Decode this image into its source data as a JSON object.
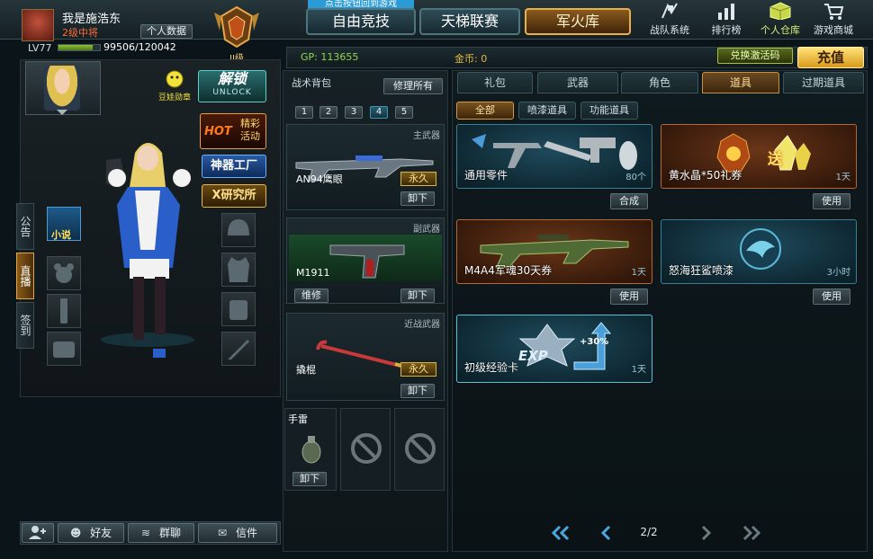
{
  "top_banner": "点击按钮回到游戏",
  "player": {
    "name": "我是施浩东",
    "rank_title": "2级中将",
    "level": "LV77",
    "xp": "99506/120042",
    "xp_fraction": 0.829,
    "profile_button": "个人数据",
    "rank_badge": "II级"
  },
  "main_nav": [
    {
      "label": "自由竞技"
    },
    {
      "label": "天梯联赛"
    },
    {
      "label": "军火库"
    }
  ],
  "top_icons": [
    {
      "label": "战队系统",
      "icon": "flag-icon"
    },
    {
      "label": "排行榜",
      "icon": "bar-chart-icon"
    },
    {
      "label": "个人仓库",
      "icon": "box-icon"
    },
    {
      "label": "游戏商城",
      "icon": "cart-icon"
    }
  ],
  "currency": {
    "gp": "GP: 113655",
    "gold": "金币: 0",
    "redeem_button": "兑换激活码",
    "recharge_button": "充值"
  },
  "left_features": {
    "unlock_main": "解锁",
    "unlock_sub": "UNLOCK",
    "mascot_label": "豆娃勋章",
    "hot_label": "HOT",
    "hot_text": "精彩活动",
    "artifact_factory": "神器工厂",
    "x_lab": "X研究所",
    "novel_label": "小说"
  },
  "side_tabs": [
    {
      "label": "公告"
    },
    {
      "label": "直播"
    },
    {
      "label": "签到"
    }
  ],
  "bottom_bar": [
    {
      "label": "",
      "icon": "add-friend-icon"
    },
    {
      "label": "好友",
      "icon": "friends-icon"
    },
    {
      "label": "群聊",
      "icon": "group-chat-icon"
    },
    {
      "label": "信件",
      "icon": "mail-icon"
    }
  ],
  "backpack": {
    "title": "战术背包",
    "repair_all": "修理所有",
    "bags": [
      "1",
      "2",
      "3",
      "4",
      "5"
    ],
    "active_bag": "4",
    "slots": [
      {
        "category": "主武器",
        "name": "AN94鹰眼",
        "badge": "永久",
        "action": "卸下"
      },
      {
        "category": "副武器",
        "name": "M1911",
        "badge": "",
        "action": "卸下",
        "secondary_action": "维修"
      },
      {
        "category": "近战武器",
        "name": "撬棍",
        "badge": "永久",
        "action": "卸下"
      }
    ],
    "grenade": {
      "name": "手雷",
      "action": "卸下"
    }
  },
  "category_tabs": [
    {
      "label": "礼包"
    },
    {
      "label": "武器"
    },
    {
      "label": "角色"
    },
    {
      "label": "道具",
      "active": true
    },
    {
      "label": "过期道具"
    }
  ],
  "sub_tabs": [
    {
      "label": "全部",
      "active": true
    },
    {
      "label": "喷漆道具"
    },
    {
      "label": "功能道具"
    }
  ],
  "items": [
    {
      "name": "通用零件",
      "duration": "80个",
      "action": "合成",
      "theme": "blue"
    },
    {
      "name": "黄水晶*50礼券",
      "duration": "1天",
      "action": "使用",
      "theme": "orange"
    },
    {
      "name": "M4A4军魂30天券",
      "duration": "1天",
      "action": "使用",
      "theme": "orange"
    },
    {
      "name": "怒海狂鲨喷漆",
      "duration": "3小时",
      "action": "使用",
      "theme": "blue"
    },
    {
      "name": "初级经验卡",
      "duration": "1天",
      "action": "",
      "theme": "blue",
      "badge": "+30%",
      "art_text": "EXP"
    }
  ],
  "send_badge": "送",
  "pagination": {
    "current": "2/2"
  },
  "colors": {
    "accent_gold": "#d8a54a",
    "accent_blue": "#3f93ad",
    "panel_bg": "#121d22"
  }
}
